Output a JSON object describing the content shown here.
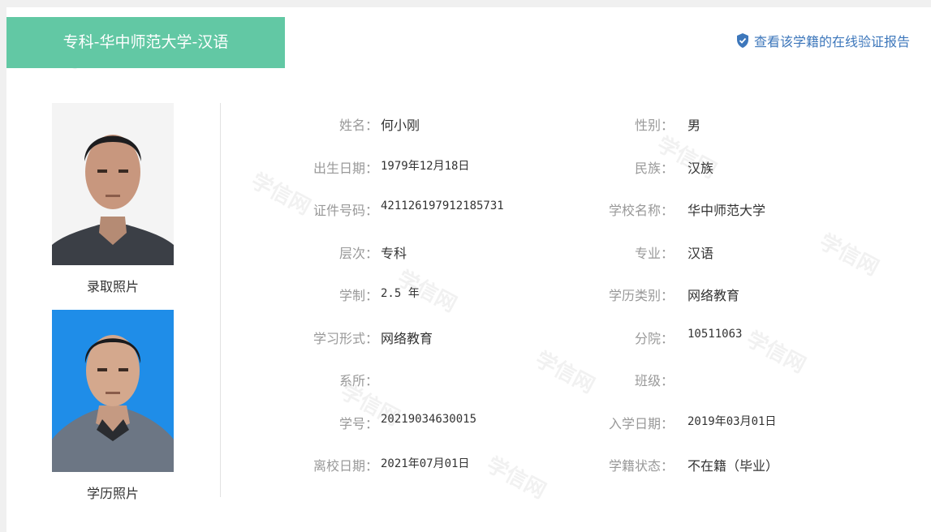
{
  "header": {
    "tab_title": "专科-华中师范大学-汉语",
    "verify_link": "查看该学籍的在线验证报告"
  },
  "photos": {
    "admission_caption": "录取照片",
    "degree_caption": "学历照片"
  },
  "watermark_text": "学信网",
  "fields": [
    {
      "left_label": "姓名：",
      "left_value": "何小刚",
      "right_label": "性别：",
      "right_value": "男"
    },
    {
      "left_label": "出生日期：",
      "left_value": "1979年12月18日",
      "right_label": "民族：",
      "right_value": "汉族"
    },
    {
      "left_label": "证件号码：",
      "left_value": "421126197912185731",
      "right_label": "学校名称：",
      "right_value": "华中师范大学"
    },
    {
      "left_label": "层次：",
      "left_value": "专科",
      "right_label": "专业：",
      "right_value": "汉语"
    },
    {
      "left_label": "学制：",
      "left_value": "2.5 年",
      "right_label": "学历类别：",
      "right_value": "网络教育"
    },
    {
      "left_label": "学习形式：",
      "left_value": "网络教育",
      "right_label": "分院：",
      "right_value": "10511063"
    },
    {
      "left_label": "系所：",
      "left_value": "",
      "right_label": "班级：",
      "right_value": ""
    },
    {
      "left_label": "学号：",
      "left_value": "20219034630015",
      "right_label": "入学日期：",
      "right_value": "2019年03月01日"
    },
    {
      "left_label": "离校日期：",
      "left_value": "2021年07月01日",
      "right_label": "学籍状态：",
      "right_value": "不在籍（毕业）"
    }
  ],
  "colors": {
    "header_tab": "#62c8a4",
    "link": "#3d77bb",
    "degree_photo_bg": "#1f8de8"
  }
}
